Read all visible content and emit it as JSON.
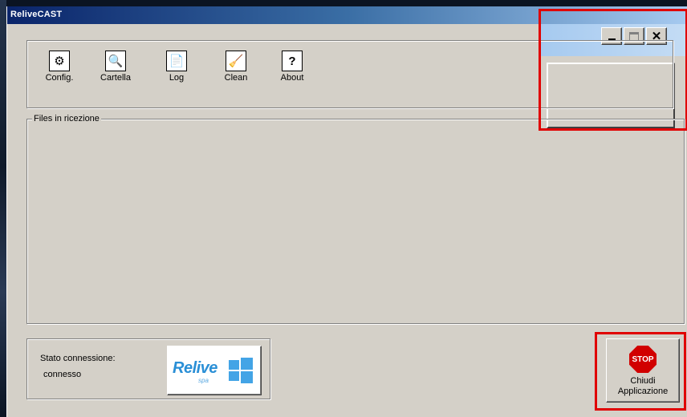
{
  "window": {
    "title": "ReliveCAST",
    "controls": {
      "minimize_icon": "minimize-icon",
      "maximize_icon": "maximize-icon",
      "close_icon": "close-icon",
      "close_glyph": "✕"
    }
  },
  "toolbar": {
    "items": [
      {
        "label": "Config.",
        "icon": "config-icon",
        "glyph": "⚙"
      },
      {
        "label": "Cartella",
        "icon": "folder-search-icon",
        "glyph": "🔍"
      },
      {
        "label": "Log",
        "icon": "log-icon",
        "glyph": "📄"
      },
      {
        "label": "Clean",
        "icon": "broom-icon",
        "glyph": "🧹"
      },
      {
        "label": "About",
        "icon": "help-icon",
        "glyph": "?"
      }
    ]
  },
  "files_panel": {
    "legend": "Files in ricezione"
  },
  "status": {
    "label": "Stato connessione:",
    "value": "connesso",
    "logo_text": "Relive",
    "logo_sub": "spa"
  },
  "stop_button": {
    "icon_text": "STOP",
    "label_line1": "Chiudi",
    "label_line2": "Applicazione"
  },
  "colors": {
    "highlight": "#e00000",
    "window_bg": "#d4d0c8",
    "title_start": "#0a246a",
    "title_end": "#a6caf0",
    "stop_red": "#d10000",
    "logo_blue": "#2a8fd6"
  }
}
